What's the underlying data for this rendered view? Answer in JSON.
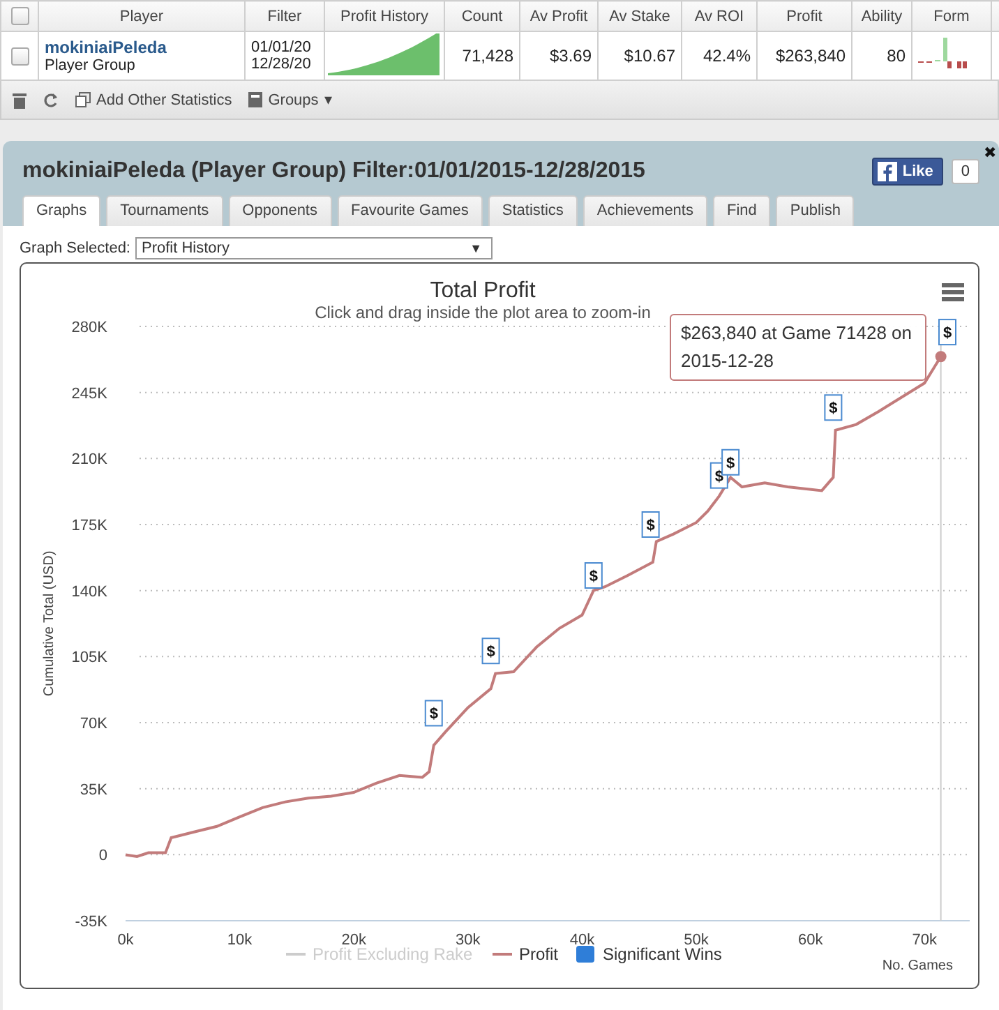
{
  "grid": {
    "select_all_checked": false,
    "columns": [
      "Player",
      "Filter",
      "Profit History",
      "Count",
      "Av Profit",
      "Av Stake",
      "Av ROI",
      "Profit",
      "Ability",
      "Form"
    ],
    "rows": [
      {
        "checked": false,
        "player": "mokiniaiPeleda",
        "player_type": "Player Group",
        "filter": [
          "01/01/20",
          "12/28/20"
        ],
        "count": "71,428",
        "av_profit": "$3.69",
        "av_stake": "$10.67",
        "av_roi": "42.4%",
        "profit": "$263,840",
        "ability": "80"
      }
    ]
  },
  "toolbar": [
    {
      "kind": "delete"
    },
    {
      "kind": "refresh"
    },
    {
      "kind": "add",
      "label": "Add Other Statistics"
    },
    {
      "kind": "groups",
      "label": "Groups",
      "caret": "▾"
    }
  ],
  "panel": {
    "title": "mokiniaiPeleda (Player Group) Filter:01/01/2015-12/28/2015",
    "like_label": "Like",
    "like_count": "0",
    "close": "✖",
    "tabs": [
      {
        "label": "Graphs",
        "selected": true
      },
      {
        "label": "Tournaments",
        "selected": false
      },
      {
        "label": "Opponents",
        "selected": false
      },
      {
        "label": "Favourite Games",
        "selected": false
      },
      {
        "label": "Statistics",
        "selected": false
      },
      {
        "label": "Achievements",
        "selected": false
      },
      {
        "label": "Find",
        "selected": false
      },
      {
        "label": "Publish",
        "selected": false
      }
    ],
    "graph_select": {
      "label": "Graph Selected:",
      "value": "Profit History",
      "arrow": "▼"
    },
    "chart": {
      "tooltip": "$263,840 at Game 71428 on 2015-12-28",
      "legend": [
        {
          "label": "Profit Excluding Rake",
          "kind": "line",
          "color": "#cccccc",
          "visible": false
        },
        {
          "kind": "series",
          "visible": true
        },
        {
          "label": "Significant Wins",
          "kind": "square",
          "color": "#2f7ed8",
          "visible": true
        }
      ],
      "chart_data": {
        "type": "line",
        "title": "Total Profit",
        "subtitle": "Click and drag inside the plot area to zoom-in",
        "xlabel": "No. Games",
        "ylabel": "Cumulative Total (USD)",
        "grid": true,
        "x": [
          0,
          1000,
          2000,
          3500,
          4000,
          6000,
          8000,
          10000,
          12000,
          14000,
          16000,
          18000,
          20000,
          22000,
          24000,
          26000,
          26600,
          27000,
          28000,
          30000,
          32000,
          32400,
          34000,
          36000,
          38000,
          40000,
          41000,
          42000,
          44000,
          46200,
          46500,
          48000,
          50000,
          51000,
          52000,
          53000,
          54000,
          56000,
          58000,
          61000,
          62000,
          62200,
          64000,
          66000,
          70000,
          71428
        ],
        "series": [
          {
            "name": "Profit",
            "color": "#c27b7b",
            "values": [
              0,
              -1000,
              1000,
              1000,
              9000,
              12000,
              15000,
              20000,
              25000,
              28000,
              30000,
              31000,
              33000,
              38000,
              42000,
              41000,
              44000,
              58000,
              65000,
              78000,
              88000,
              96000,
              97000,
              110000,
              120000,
              127000,
              140000,
              142000,
              148000,
              155000,
              166000,
              170000,
              176000,
              182000,
              190000,
              200000,
              195000,
              197000,
              195000,
              193000,
              200000,
              225000,
              228000,
              235000,
              250000,
              264000
            ]
          }
        ],
        "ref_lines": [
          {
            "axis": "x",
            "value": 71428
          }
        ],
        "xlim": [
          0,
          72000
        ],
        "ylim": [
          -35000,
          280000
        ],
        "xticks": [
          {
            "value": 0,
            "label": "0k"
          },
          {
            "value": 10000,
            "label": "10k"
          },
          {
            "value": 20000,
            "label": "20k"
          },
          {
            "value": 30000,
            "label": "30k"
          },
          {
            "value": 40000,
            "label": "40k"
          },
          {
            "value": 50000,
            "label": "50k"
          },
          {
            "value": 60000,
            "label": "60k"
          },
          {
            "value": 70000,
            "label": "70k"
          }
        ],
        "yticks": [
          {
            "value": 280000,
            "label": "280K"
          },
          {
            "value": 245000,
            "label": "245K"
          },
          {
            "value": 210000,
            "label": "210K"
          },
          {
            "value": 175000,
            "label": "175K"
          },
          {
            "value": 140000,
            "label": "140K"
          },
          {
            "value": 105000,
            "label": "105K"
          },
          {
            "value": 70000,
            "label": "70K"
          },
          {
            "value": 35000,
            "label": "35K"
          },
          {
            "value": 0,
            "label": "0"
          },
          {
            "value": -35000,
            "label": "-35K"
          }
        ],
        "annotations": [
          {
            "x": 27000,
            "y": 75000,
            "text": "$"
          },
          {
            "x": 32000,
            "y": 108000,
            "text": "$"
          },
          {
            "x": 41000,
            "y": 148000,
            "text": "$"
          },
          {
            "x": 46000,
            "y": 175000,
            "text": "$"
          },
          {
            "x": 52000,
            "y": 201000,
            "text": "$"
          },
          {
            "x": 53000,
            "y": 208000,
            "text": "$"
          },
          {
            "x": 62000,
            "y": 237000,
            "text": "$"
          },
          {
            "x": 72000,
            "y": 277000,
            "text": "$"
          }
        ]
      }
    }
  }
}
